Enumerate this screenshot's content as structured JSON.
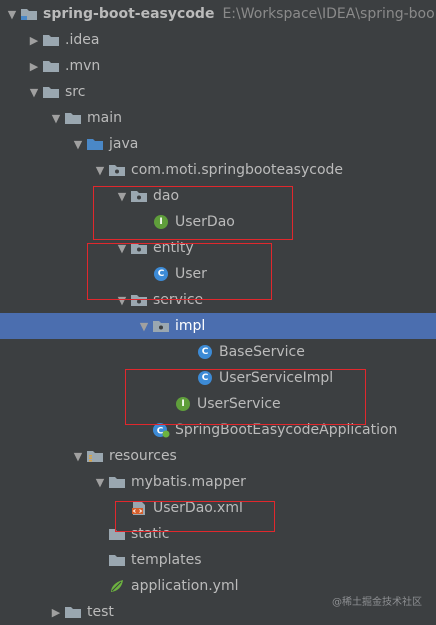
{
  "project": {
    "name": "spring-boot-easycode",
    "path": "E:\\Workspace\\IDEA\\spring-boot"
  },
  "tree": [
    {
      "label": "spring-boot-easycode",
      "path": "E:\\Workspace\\IDEA\\spring-boo",
      "indent": 0,
      "arrow": "open",
      "icon": "module-folder-icon",
      "bold": true,
      "name": "tree-item-project-root"
    },
    {
      "label": ".idea",
      "indent": 1,
      "arrow": "closed",
      "icon": "folder-icon",
      "name": "tree-item-idea"
    },
    {
      "label": ".mvn",
      "indent": 1,
      "arrow": "closed",
      "icon": "folder-icon",
      "name": "tree-item-mvn"
    },
    {
      "label": "src",
      "indent": 1,
      "arrow": "open",
      "icon": "folder-icon",
      "name": "tree-item-src"
    },
    {
      "label": "main",
      "indent": 2,
      "arrow": "open",
      "icon": "folder-icon",
      "name": "tree-item-main"
    },
    {
      "label": "java",
      "indent": 3,
      "arrow": "open",
      "icon": "source-folder-icon",
      "name": "tree-item-java"
    },
    {
      "label": "com.moti.springbooteasycode",
      "indent": 4,
      "arrow": "open",
      "icon": "package-icon",
      "name": "tree-item-root-package"
    },
    {
      "label": "dao",
      "indent": 5,
      "arrow": "open",
      "icon": "package-icon",
      "name": "tree-item-dao"
    },
    {
      "label": "UserDao",
      "indent": 6,
      "arrow": "none",
      "icon": "interface-icon",
      "name": "tree-item-userdao"
    },
    {
      "label": "entity",
      "indent": 5,
      "arrow": "open",
      "icon": "package-icon",
      "name": "tree-item-entity"
    },
    {
      "label": "User",
      "indent": 6,
      "arrow": "none",
      "icon": "class-icon",
      "name": "tree-item-user"
    },
    {
      "label": "service",
      "indent": 5,
      "arrow": "open",
      "icon": "package-icon",
      "name": "tree-item-service"
    },
    {
      "label": "impl",
      "indent": 6,
      "arrow": "open",
      "icon": "package-icon",
      "selected": true,
      "name": "tree-item-impl"
    },
    {
      "label": "BaseService",
      "indent": 8,
      "arrow": "none",
      "icon": "class-icon",
      "name": "tree-item-baseservice"
    },
    {
      "label": "UserServiceImpl",
      "indent": 8,
      "arrow": "none",
      "icon": "class-icon",
      "name": "tree-item-userserviceimpl"
    },
    {
      "label": "UserService",
      "indent": 7,
      "arrow": "none",
      "icon": "interface-icon",
      "name": "tree-item-userservice"
    },
    {
      "label": "SpringBootEasycodeApplication",
      "indent": 6,
      "arrow": "none",
      "icon": "spring-boot-class-icon",
      "name": "tree-item-application-class"
    },
    {
      "label": "resources",
      "indent": 3,
      "arrow": "open",
      "icon": "resources-folder-icon",
      "name": "tree-item-resources"
    },
    {
      "label": "mybatis.mapper",
      "indent": 4,
      "arrow": "open",
      "icon": "folder-icon",
      "name": "tree-item-mybatis-mapper"
    },
    {
      "label": "UserDao.xml",
      "indent": 5,
      "arrow": "none",
      "icon": "xml-file-icon",
      "name": "tree-item-userdao-xml"
    },
    {
      "label": "static",
      "indent": 4,
      "arrow": "none",
      "icon": "folder-icon",
      "name": "tree-item-static"
    },
    {
      "label": "templates",
      "indent": 4,
      "arrow": "none",
      "icon": "folder-icon",
      "name": "tree-item-templates"
    },
    {
      "label": "application.yml",
      "indent": 4,
      "arrow": "none",
      "icon": "yml-file-icon",
      "name": "tree-item-application-yml"
    },
    {
      "label": "test",
      "indent": 2,
      "arrow": "closed",
      "icon": "folder-icon",
      "name": "tree-item-test"
    }
  ],
  "watermark": "@稀土掘金技术社区",
  "colors": {
    "background": "#3c3f41",
    "selection": "#4b6eaf",
    "highlight_box": "#e0282d",
    "class_icon": "#3d8bd6",
    "interface_icon": "#5f9e3b"
  }
}
